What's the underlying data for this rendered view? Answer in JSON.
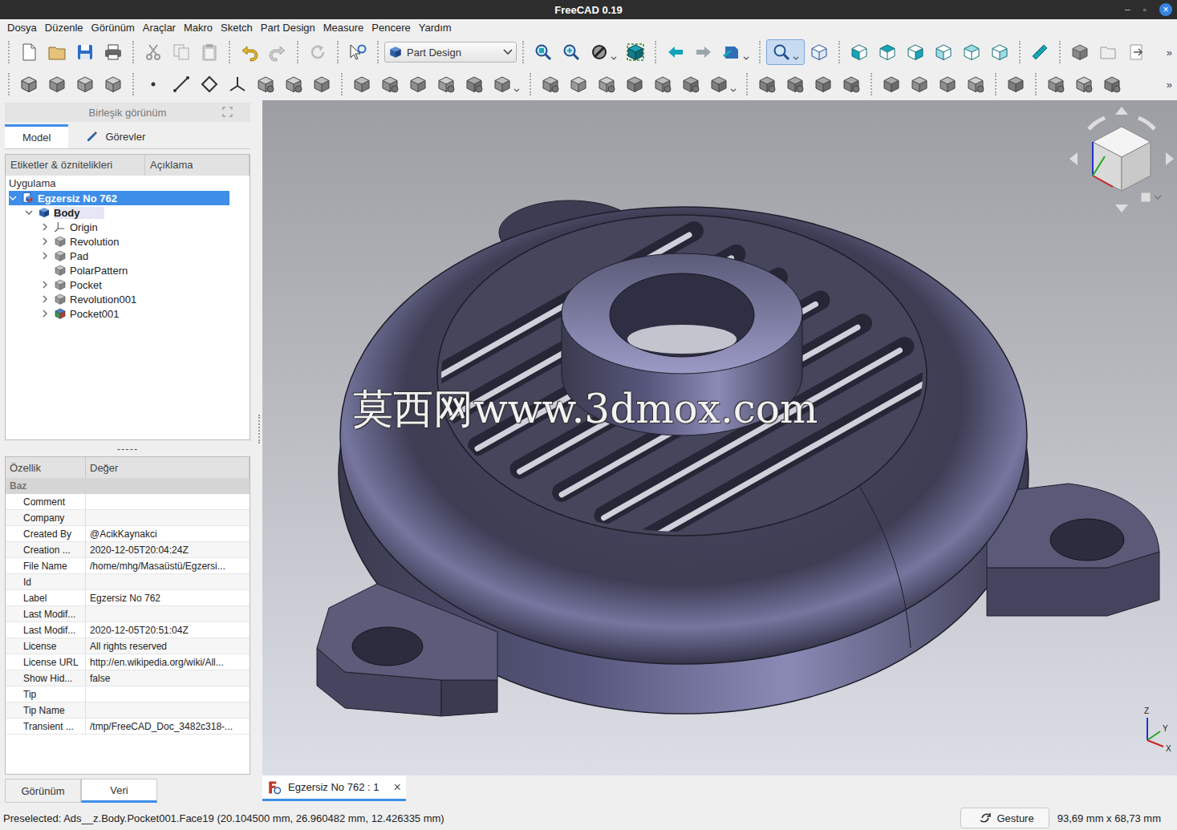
{
  "window": {
    "title": "FreeCAD 0.19",
    "controls": [
      "–",
      "▫",
      "×"
    ]
  },
  "menu": [
    "Dosya",
    "Düzenle",
    "Görünüm",
    "Araçlar",
    "Makro",
    "Sketch",
    "Part Design",
    "Measure",
    "Pencere",
    "Yardım"
  ],
  "toolbar": {
    "workbench": "Part Design",
    "view_menu_checked": true,
    "overflow": "»"
  },
  "panel": {
    "title": "Birleşik görünüm",
    "tabs": [
      {
        "label": "Model",
        "selected": true
      },
      {
        "label": "Görevler",
        "selected": false
      }
    ]
  },
  "tree": {
    "columns": [
      "Etiketler & öznitelikleri",
      "Açıklama"
    ],
    "group": "Uygulama",
    "items": [
      {
        "label": "Egzersiz No 762",
        "level": 0,
        "kind": "document",
        "has_children": true,
        "expanded": true,
        "selected": true,
        "active": false
      },
      {
        "label": "Body",
        "level": 1,
        "kind": "body",
        "has_children": true,
        "expanded": true,
        "selected": false,
        "active": true
      },
      {
        "label": "Origin",
        "level": 2,
        "kind": "origin",
        "has_children": true,
        "expanded": false,
        "selected": false,
        "active": false
      },
      {
        "label": "Revolution",
        "level": 2,
        "kind": "feature",
        "has_children": true,
        "expanded": false,
        "selected": false,
        "active": false
      },
      {
        "label": "Pad",
        "level": 2,
        "kind": "feature",
        "has_children": true,
        "expanded": false,
        "selected": false,
        "active": false
      },
      {
        "label": "PolarPattern",
        "level": 2,
        "kind": "feature",
        "has_children": false,
        "expanded": false,
        "selected": false,
        "active": false
      },
      {
        "label": "Pocket",
        "level": 2,
        "kind": "feature",
        "has_children": true,
        "expanded": false,
        "selected": false,
        "active": false
      },
      {
        "label": "Revolution001",
        "level": 2,
        "kind": "feature",
        "has_children": true,
        "expanded": false,
        "selected": false,
        "active": false
      },
      {
        "label": "Pocket001",
        "level": 2,
        "kind": "tip",
        "has_children": true,
        "expanded": false,
        "selected": false,
        "active": false
      }
    ]
  },
  "splitter": "-----",
  "properties": {
    "columns": [
      "Özellik",
      "Değer"
    ],
    "group": "Baz",
    "rows": [
      [
        "Comment",
        ""
      ],
      [
        "Company",
        ""
      ],
      [
        "Created By",
        "@AcikKaynakci"
      ],
      [
        "Creation ...",
        "2020-12-05T20:04:24Z"
      ],
      [
        "File Name",
        "/home/mhg/Masaüstü/Egzersi..."
      ],
      [
        "Id",
        ""
      ],
      [
        "Label",
        "Egzersiz No 762"
      ],
      [
        "Last Modif...",
        ""
      ],
      [
        "Last Modif...",
        "2020-12-05T20:51:04Z"
      ],
      [
        "License",
        "All rights reserved"
      ],
      [
        "License URL",
        "http://en.wikipedia.org/wiki/All..."
      ],
      [
        "Show Hid...",
        "false"
      ],
      [
        "Tip",
        ""
      ],
      [
        "Tip Name",
        ""
      ],
      [
        "Transient ...",
        "/tmp/FreeCAD_Doc_3482c318-..."
      ]
    ]
  },
  "panel_bottom_tabs": [
    {
      "label": "Görünüm",
      "selected": false
    },
    {
      "label": "Veri",
      "selected": true
    }
  ],
  "view": {
    "watermark": "莫西网www.3dmox.com",
    "axes": [
      "Z",
      "Y",
      "X"
    ]
  },
  "document_tabs": [
    {
      "label": "Egzersiz No 762 : 1",
      "close": "×",
      "selected": true
    }
  ],
  "status_bar": {
    "message": "Preselected: Ads__z.Body.Pocket001.Face19 (20.104500 mm, 26.960482 mm, 12.426335 mm)",
    "navigation": "Gesture",
    "dimensions": "93,69 mm x 68,73 mm"
  }
}
